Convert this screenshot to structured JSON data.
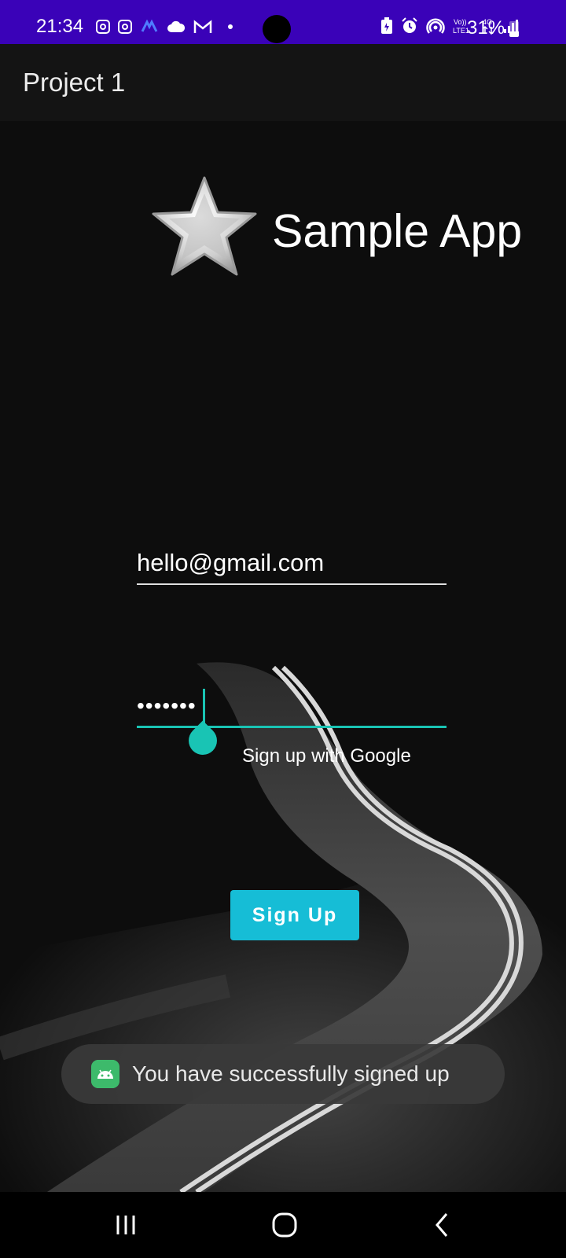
{
  "status_bar": {
    "time": "21:34",
    "battery": "31%",
    "network": "4G",
    "volte": "LTE1",
    "colors": {
      "background": "#3a02b8"
    },
    "left_icons": [
      "instagram-icon",
      "instagram-icon",
      "messenger-icon",
      "cloud-icon",
      "gmail-icon"
    ],
    "right_icons": [
      "battery-saver-icon",
      "alarm-icon",
      "hotspot-icon",
      "volte-icon",
      "mobile-data-icon",
      "signal-icon",
      "battery-icon"
    ]
  },
  "app_bar": {
    "title": "Project 1"
  },
  "logo": {
    "icon": "star-icon",
    "text": "Sample App"
  },
  "form": {
    "email_value": "hello@gmail.com",
    "password_value": "•••••••",
    "google_link": "Sign up with Google",
    "signup_label": "Sign Up",
    "accent_color": "#19c4b4",
    "button_color": "#16bdd6"
  },
  "toast": {
    "icon": "android-icon",
    "message": "You have successfully signed up"
  },
  "nav_bar": {
    "buttons": [
      "recent-apps-icon",
      "home-icon",
      "back-icon"
    ]
  }
}
